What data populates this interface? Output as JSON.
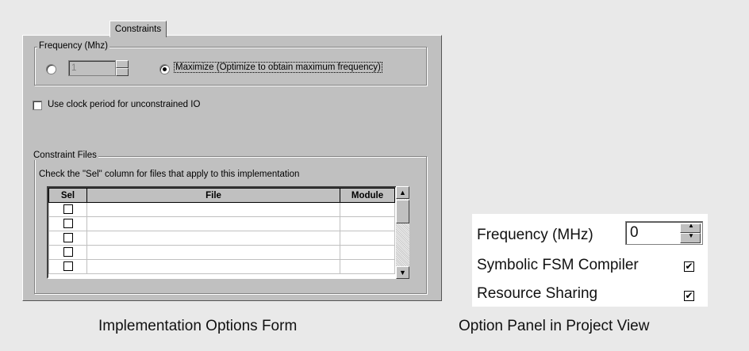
{
  "form": {
    "tab_label": "Constraints",
    "frequency_group": {
      "legend": "Frequency (Mhz)",
      "value": "1",
      "maximize_label": "Maximize (Optimize to obtain maximum frequency)"
    },
    "clock_period_label": "Use clock period for unconstrained IO",
    "constraint_files_group": {
      "legend": "Constraint Files",
      "instruction": "Check the \"Sel\" column for files that apply to this implementation",
      "columns": [
        "Sel",
        "File",
        "Module"
      ],
      "rows": [
        {
          "sel": false,
          "file": "",
          "module": ""
        },
        {
          "sel": false,
          "file": "",
          "module": ""
        },
        {
          "sel": false,
          "file": "",
          "module": ""
        },
        {
          "sel": false,
          "file": "",
          "module": ""
        },
        {
          "sel": false,
          "file": "",
          "module": ""
        }
      ]
    }
  },
  "captions": {
    "left": "Implementation Options Form",
    "right": "Option Panel in Project View"
  },
  "panel": {
    "frequency_label": "Frequency (MHz)",
    "frequency_value": "0",
    "fsm_label": "Symbolic FSM Compiler",
    "fsm_checked": true,
    "resource_label": "Resource Sharing",
    "resource_checked": true,
    "check_glyph": "✔"
  },
  "colors": {
    "background": "#e9e9e9",
    "dialog_face": "#c0c0c0",
    "panel_bg": "#ffffff"
  }
}
